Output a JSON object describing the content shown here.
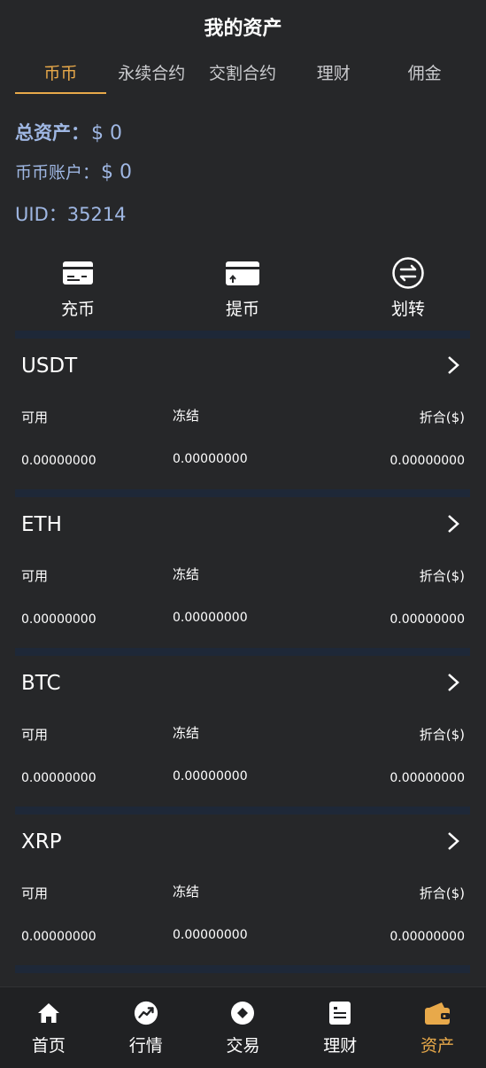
{
  "header": {
    "title": "我的资产"
  },
  "tabs": [
    {
      "label": "币币"
    },
    {
      "label": "永续合约"
    },
    {
      "label": "交割合约"
    },
    {
      "label": "理财"
    },
    {
      "label": "佣金"
    }
  ],
  "summary": {
    "total_label": "总资产：",
    "total_value": "$ 0",
    "account_label": "币币账户：",
    "account_value": "$ 0",
    "uid_label": "UID：",
    "uid_value": "35214"
  },
  "actions": [
    {
      "label": "充币",
      "icon": "card-icon"
    },
    {
      "label": "提币",
      "icon": "card-upload-icon"
    },
    {
      "label": "划转",
      "icon": "transfer-icon"
    }
  ],
  "columns": {
    "available": "可用",
    "frozen": "冻结",
    "converted": "折合($)"
  },
  "coins": [
    {
      "name": "USDT",
      "available": "0.00000000",
      "frozen": "0.00000000",
      "converted": "0.00000000"
    },
    {
      "name": "ETH",
      "available": "0.00000000",
      "frozen": "0.00000000",
      "converted": "0.00000000"
    },
    {
      "name": "BTC",
      "available": "0.00000000",
      "frozen": "0.00000000",
      "converted": "0.00000000"
    },
    {
      "name": "XRP",
      "available": "0.00000000",
      "frozen": "0.00000000",
      "converted": "0.00000000"
    }
  ],
  "nav": [
    {
      "label": "首页",
      "icon": "home-icon"
    },
    {
      "label": "行情",
      "icon": "market-trend-icon"
    },
    {
      "label": "交易",
      "icon": "trade-icon"
    },
    {
      "label": "理财",
      "icon": "finance-doc-icon"
    },
    {
      "label": "资产",
      "icon": "wallet-icon"
    }
  ],
  "colors": {
    "accent": "#e8a94a",
    "background": "#262729",
    "summary_text": "#9fb7e3",
    "divider": "#1e2838"
  }
}
